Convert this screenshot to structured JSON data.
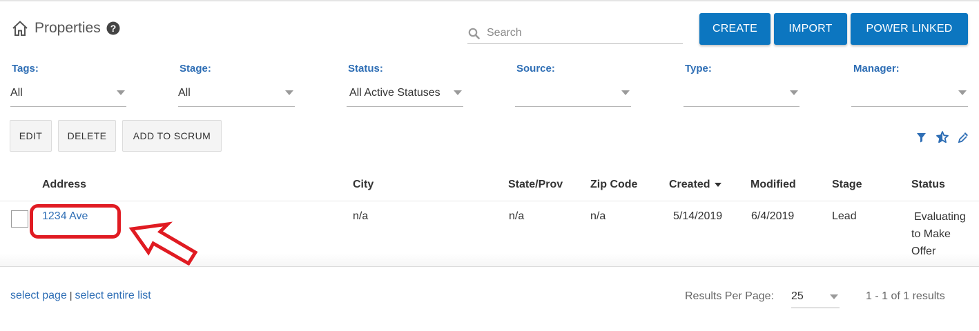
{
  "header": {
    "title": "Properties",
    "search_placeholder": "Search",
    "buttons": {
      "create": "CREATE",
      "import": "IMPORT",
      "power_linked": "POWER LINKED"
    }
  },
  "filters": {
    "tags": {
      "label": "Tags:",
      "value": "All"
    },
    "stage": {
      "label": "Stage:",
      "value": "All"
    },
    "status": {
      "label": "Status:",
      "value": "All Active Statuses"
    },
    "source": {
      "label": "Source:",
      "value": ""
    },
    "type": {
      "label": "Type:",
      "value": ""
    },
    "manager": {
      "label": "Manager:",
      "value": ""
    }
  },
  "actions": {
    "edit": "EDIT",
    "delete": "DELETE",
    "add_to_scrum": "ADD TO SCRUM"
  },
  "table": {
    "columns": {
      "address": "Address",
      "city": "City",
      "state": "State/Prov",
      "zip": "Zip Code",
      "created": "Created",
      "modified": "Modified",
      "stage": "Stage",
      "status": "Status"
    },
    "rows": [
      {
        "address": "1234 Ave",
        "city": "n/a",
        "state": "n/a",
        "zip": "n/a",
        "created": "5/14/2019",
        "modified": "6/4/2019",
        "stage": "Lead",
        "status": "Evaluating to Make Offer"
      }
    ]
  },
  "footer": {
    "select_page": "select page",
    "separator": "|",
    "select_entire_list": "select entire list",
    "results_per_page_label": "Results Per Page:",
    "results_per_page_value": "25",
    "results_text": "1 - 1 of 1 results"
  },
  "colors": {
    "primary": "#0c76c0",
    "link": "#2e6eb5",
    "highlight": "#e01b22"
  },
  "icons": [
    "home-icon",
    "help-icon",
    "search-icon",
    "filter-icon",
    "star-icon",
    "eyedropper-icon",
    "sort-desc-icon"
  ]
}
